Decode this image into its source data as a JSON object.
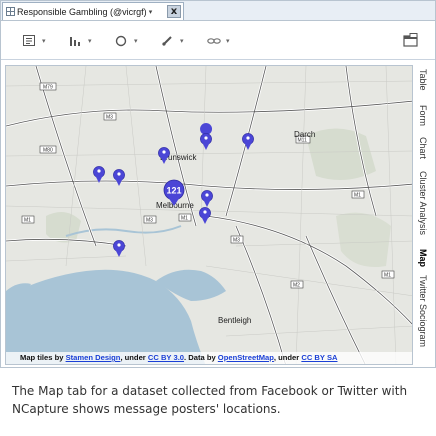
{
  "window": {
    "tab_title": "Responsible Gambling (@vicrgf)",
    "tab_close": "x"
  },
  "toolbar": {
    "buttons": [
      {
        "icon": "display-options-icon"
      },
      {
        "icon": "bar-chart-icon"
      },
      {
        "icon": "shape-icon"
      },
      {
        "icon": "brush-icon"
      },
      {
        "icon": "link-icon"
      }
    ],
    "right_icon": "export-icon"
  },
  "map": {
    "places": [
      "Brunswick",
      "Melbourne",
      "Darch",
      "Bentleigh"
    ],
    "cluster_count": "121",
    "road_labels": [
      "M79",
      "M80",
      "M3",
      "M1",
      "M3",
      "M1",
      "M3",
      "M1",
      "M2",
      "M1",
      "M11"
    ],
    "attribution": {
      "prefix": "Map tiles by ",
      "link1": "Stamen Design",
      "mid1": ", under ",
      "link2": "CC BY 3.0",
      "mid2": ". Data by ",
      "link3": "OpenStreetMap",
      "mid3": ", under ",
      "link4": "CC BY SA"
    },
    "colors": {
      "water": "#a8c4d6",
      "land": "#e9eae6",
      "marker": "#4b46d6"
    }
  },
  "side_tabs": [
    {
      "label": "Table",
      "active": false
    },
    {
      "label": "Form",
      "active": false
    },
    {
      "label": "Chart",
      "active": false
    },
    {
      "label": "Cluster Analysis",
      "active": false
    },
    {
      "label": "Map",
      "active": true
    },
    {
      "label": "Twitter Sociogram",
      "active": false
    }
  ],
  "caption": "The Map tab for a dataset collected from Facebook or Twitter with NCapture shows message posters' locations."
}
